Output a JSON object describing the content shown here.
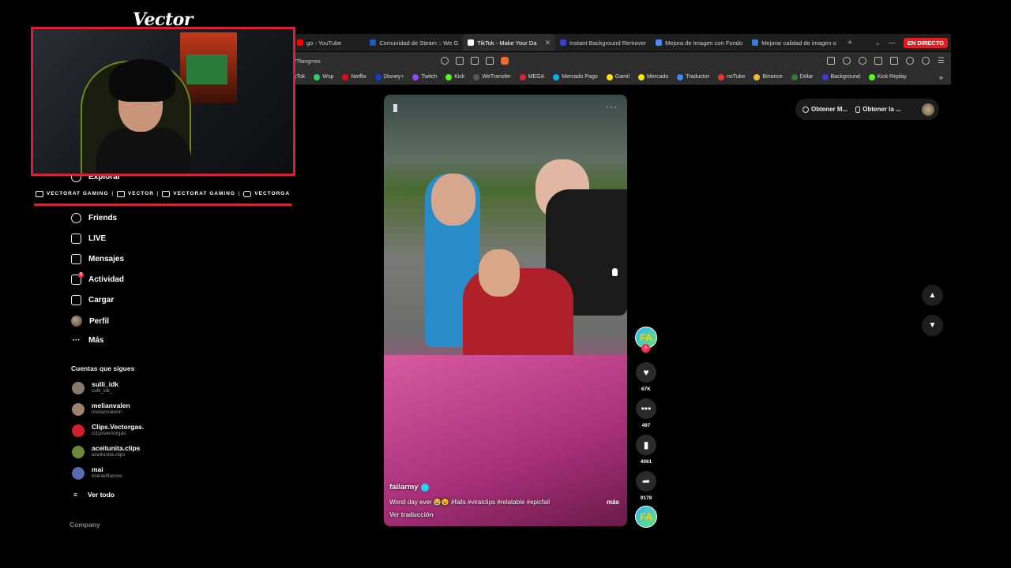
{
  "stream": {
    "logo": "Vector",
    "live_badge": "EN DIRECTO",
    "social": [
      {
        "label": "VECTORAT GAMING",
        "icon": "youtube-icon"
      },
      {
        "label": "VECTOR",
        "icon": "chat-icon"
      },
      {
        "label": "VECTORAT GAMING",
        "icon": "twitter-icon"
      },
      {
        "label": "VECTORGA",
        "icon": "instagram-icon"
      }
    ]
  },
  "browser": {
    "tabs": [
      {
        "label": "go - YouTube",
        "color": "#ff0000"
      },
      {
        "label": "Comunidad de Steam :: We G",
        "color": "#1b5bbf"
      },
      {
        "label": "TikTok - Make Your Da",
        "color": "#ffffff",
        "active": true
      },
      {
        "label": "Instant Background Remover",
        "color": "#3b3bd6"
      },
      {
        "label": "Mejora de Imagen con Fondo",
        "color": "#4b8bf5"
      },
      {
        "label": "Mejorar calidad de imagen o",
        "color": "#3a7bd5"
      }
    ],
    "url": "/?lang=es",
    "bookmarks": [
      {
        "label": "kTok",
        "color": "#222"
      },
      {
        "label": "Wsp",
        "color": "#25d366"
      },
      {
        "label": "Netflix",
        "color": "#e50914"
      },
      {
        "label": "Disney+",
        "color": "#113ccf"
      },
      {
        "label": "Twitch",
        "color": "#9146ff"
      },
      {
        "label": "Kick",
        "color": "#53fc18"
      },
      {
        "label": "WeTransfer",
        "color": "#333"
      },
      {
        "label": "MEGA",
        "color": "#d9272e"
      },
      {
        "label": "Mercado Pago",
        "color": "#00b1ea"
      },
      {
        "label": "Gamil",
        "color": "#ffe600"
      },
      {
        "label": "Mercado",
        "color": "#ffe600"
      },
      {
        "label": "Traductor",
        "color": "#4285f4"
      },
      {
        "label": "noTube",
        "color": "#e53935"
      },
      {
        "label": "Binance",
        "color": "#f3ba2f"
      },
      {
        "label": "Dólar",
        "color": "#2e7d32"
      },
      {
        "label": "Background",
        "color": "#3b3bd6"
      },
      {
        "label": "Kick Replay",
        "color": "#53fc18"
      }
    ]
  },
  "sidebar": {
    "nav": [
      {
        "label": "Explorar",
        "icon": "compass-icon"
      },
      {
        "label": "Friends",
        "icon": "friends-icon"
      },
      {
        "label": "LIVE",
        "icon": "live-icon"
      },
      {
        "label": "Mensajes",
        "icon": "send-icon"
      },
      {
        "label": "Actividad",
        "icon": "activity-icon",
        "badge": "3"
      },
      {
        "label": "Cargar",
        "icon": "upload-icon"
      },
      {
        "label": "Perfil",
        "icon": "avatar"
      },
      {
        "label": "Más",
        "icon": "more-icon"
      }
    ],
    "following_title": "Cuentas que sigues",
    "accounts": [
      {
        "name": "sulli_idk",
        "handle": "sulli_idk_",
        "color": "#8a7a6a"
      },
      {
        "name": "melianvalen",
        "handle": "melianvalenn",
        "color": "#a08070"
      },
      {
        "name": "Clips.Vectorgas.",
        "handle": "cl1psvectorgas",
        "color": "#d02030"
      },
      {
        "name": "aceitunita.clips",
        "handle": "aceitunita.clips",
        "color": "#6a8a3a"
      },
      {
        "name": "mai",
        "handle": "maravillacore",
        "color": "#5a6ab0"
      }
    ],
    "see_all": "Ver todo",
    "company": "Company"
  },
  "video": {
    "author": "failarmy",
    "caption": "Worst day ever 😭😵 #fails #viralclips #relatable #epicfail",
    "more": "más",
    "translate": "Ver traducción",
    "avatar_text": "FA"
  },
  "actions": {
    "likes": "67K",
    "comments": "497",
    "saves": "4061",
    "shares": "9178"
  },
  "top_right": {
    "btn1": "Obtener M...",
    "btn2": "Obtener la ..."
  }
}
